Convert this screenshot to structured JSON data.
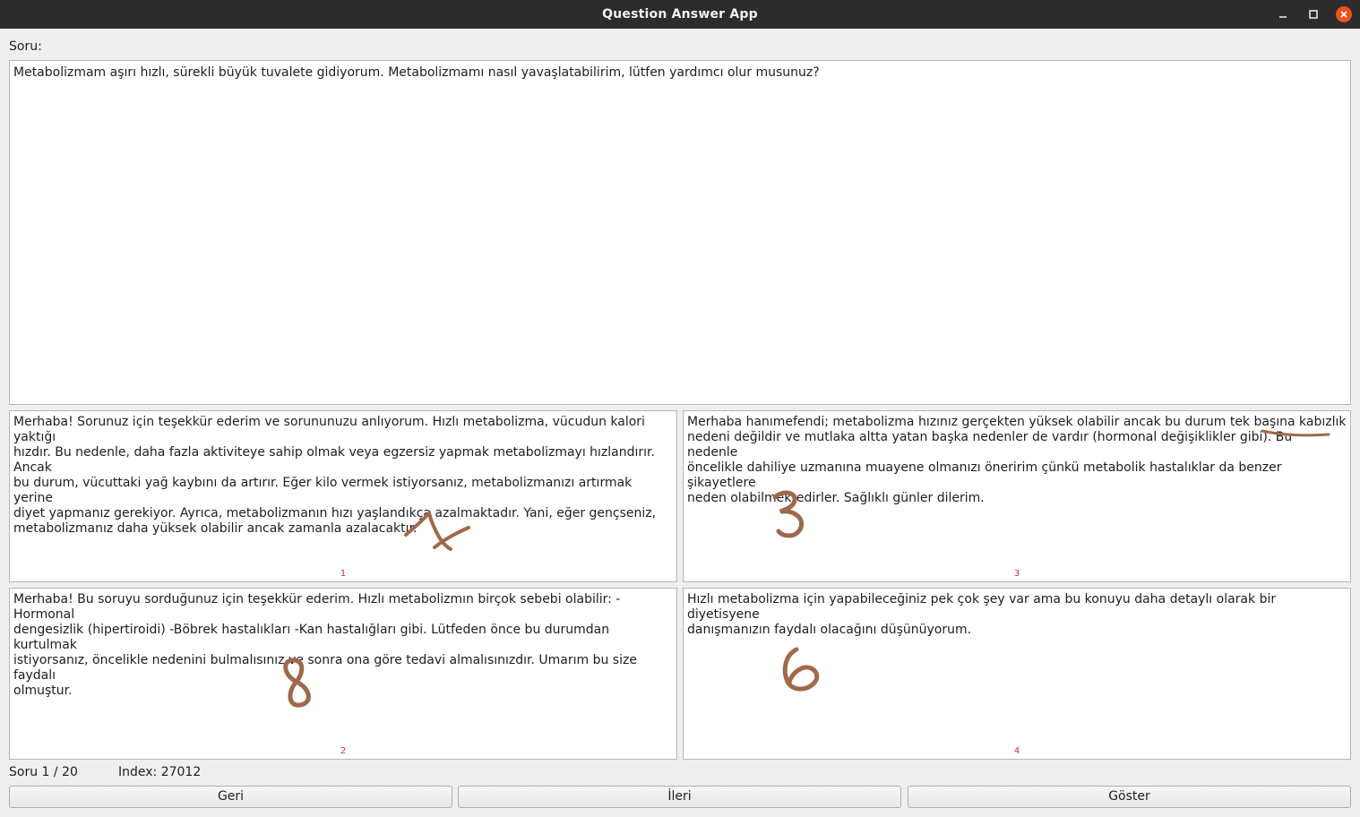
{
  "window": {
    "title": "Question Answer App",
    "controls": [
      "minimize-icon",
      "maximize-icon",
      "close-icon"
    ],
    "close_color": "#e95420"
  },
  "question": {
    "label": "Soru:",
    "text": "Metabolizmam aşırı hızlı, sürekli büyük tuvalete gidiyorum. Metabolizmamı nasıl yavaşlatabilirim, lütfen yardımcı olur musunuz?"
  },
  "answers": [
    {
      "number": "1",
      "text": "Merhaba! Sorunuz için teşekkür ederim ve sorununuzu anlıyorum. Hızlı metabolizma, vücudun kalori yaktığı\nhızdır. Bu nedenle, daha fazla aktiviteye sahip olmak veya egzersiz yapmak metabolizmayı hızlandırır. Ancak\nbu durum, vücuttaki yağ kaybını da artırır. Eğer kilo vermek istiyorsanız, metabolizmanızı artırmak yerine\ndiyet yapmanız gerekiyor. Ayrıca, metabolizmanın hızı yaşlandıkça azalmaktadır. Yani, eğer gençseniz,\nmetabolizmanız daha yüksek olabilir ancak zamanla azalacaktır."
    },
    {
      "number": "3",
      "text": "Merhaba hanımefendi; metabolizma hızınız gerçekten yüksek olabilir ancak bu durum tek başına kabızlık\nnedeni değildir ve mutlaka altta yatan başka nedenler de vardır (hormonal değişiklikler gibi). Bu nedenle\nöncelikle dahiliye uzmanına muayene olmanızı öneririm çünkü metabolik hastalıklar da benzer şikayetlere\nneden olabilmektedirler. Sağlıklı günler dilerim."
    },
    {
      "number": "2",
      "text": "Merhaba! Bu soruyu sorduğunuz için teşekkür ederim. Hızlı metabolizmın birçok sebebi olabilir: -Hormonal\ndengesizlik (hipertiroidi) -Böbrek hastalıkları -Kan hastalığları gibi. Lütfeden önce bu durumdan kurtulmak\nistiyorsanız, öncelikle nedenini bulmalısınız ve sonra ona göre tedavi almalısınızdır. Umarım bu size faydalı\nolmuştur."
    },
    {
      "number": "4",
      "text": "Hızlı metabolizma için yapabileceğiniz pek çok şey var ama bu konuyu daha detaylı olarak bir diyetisyene\ndanışmanızın faydalı olacağını düşünüyorum."
    }
  ],
  "handwritten_marks": {
    "color": "#a0684a",
    "panel_1": "1",
    "panel_3": "3",
    "panel_2": "8",
    "panel_4": "6"
  },
  "status": {
    "count": "Soru 1 / 20",
    "index": "Index: 27012"
  },
  "buttons": {
    "back": "Geri",
    "next": "İleri",
    "show": "Göster"
  }
}
